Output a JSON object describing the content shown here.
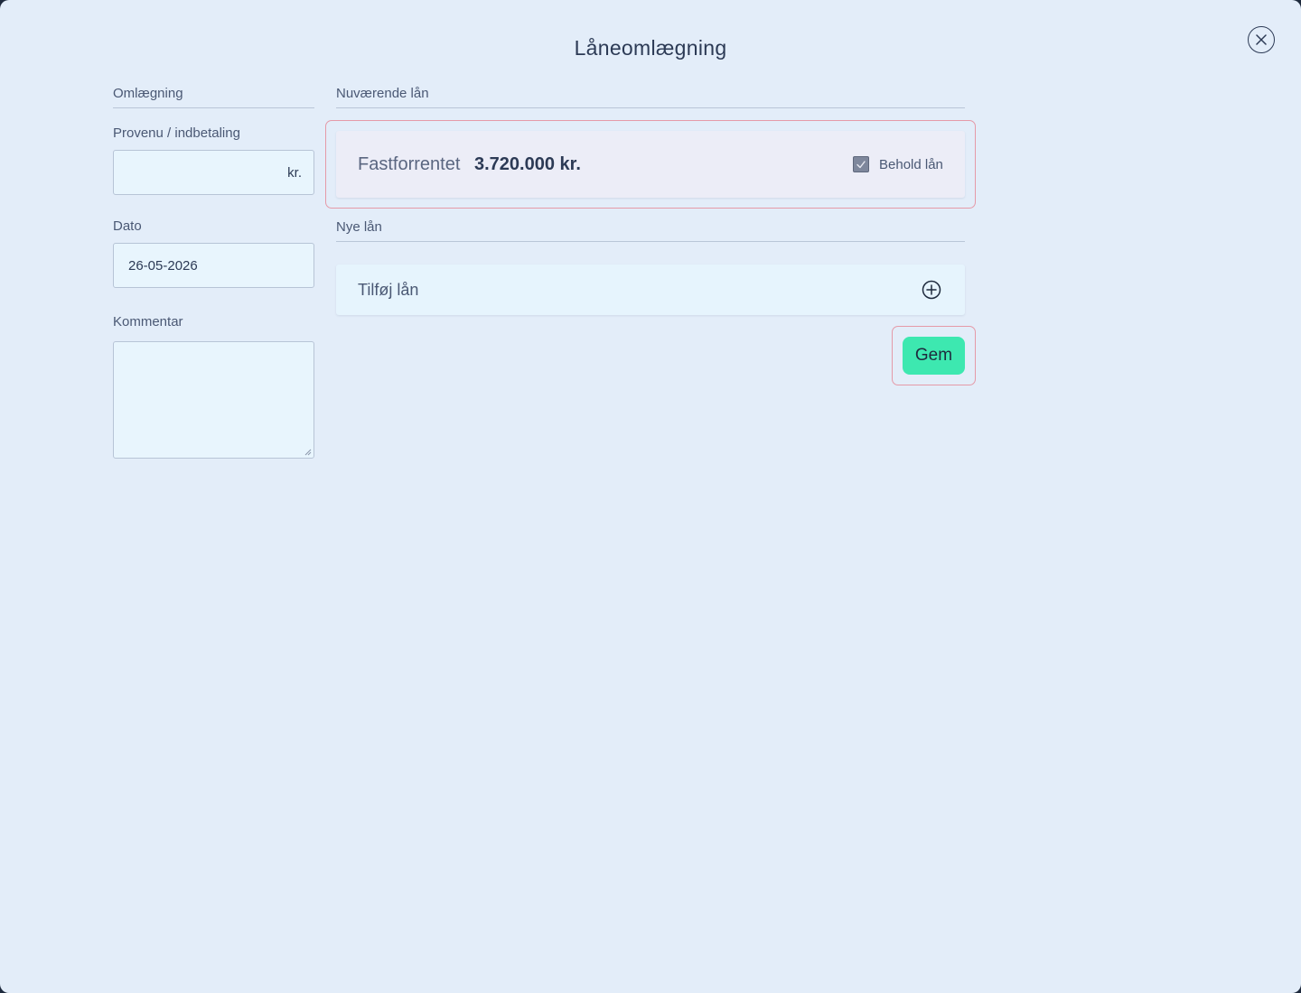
{
  "dialog": {
    "title": "Låneomlægning",
    "close_icon": "close-icon"
  },
  "left": {
    "section_title": "Omlægning",
    "proceeds": {
      "label": "Provenu / indbetaling",
      "value": "",
      "suffix": "kr."
    },
    "date": {
      "label": "Dato",
      "value": "26-05-2026"
    },
    "comment": {
      "label": "Kommentar",
      "value": ""
    }
  },
  "current_loans": {
    "section_title": "Nuværende lån",
    "items": [
      {
        "type": "Fastforrentet",
        "amount": "3.720.000 kr.",
        "keep_label": "Behold lån",
        "keep_checked": true
      }
    ]
  },
  "new_loans": {
    "section_title": "Nye lån",
    "add_label": "Tilføj lån",
    "add_icon": "plus-circle-icon"
  },
  "actions": {
    "save_label": "Gem"
  },
  "colors": {
    "background": "#e3edf9",
    "accent": "#3de8b0",
    "highlight_outline": "#e59aa8",
    "text": "#2c3a55"
  }
}
